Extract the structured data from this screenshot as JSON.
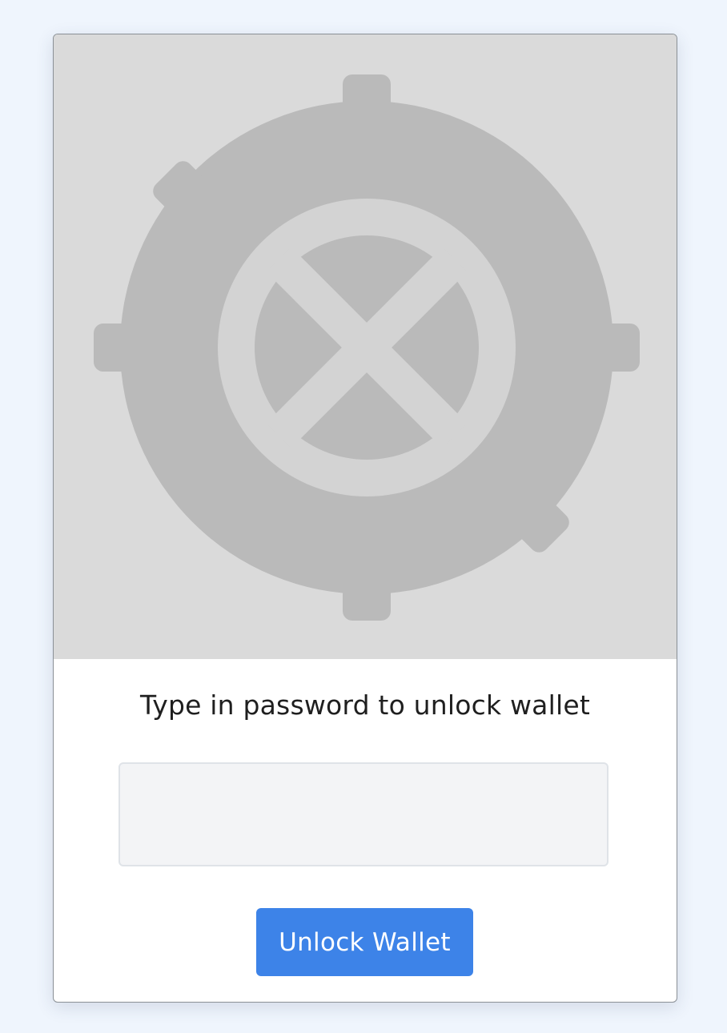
{
  "hero": {
    "icon": "vault-door-icon",
    "background_color": "#dadada",
    "icon_color": "#bababa",
    "inner_ring_color": "#d3d3d3"
  },
  "unlock": {
    "prompt": "Type in password to unlock wallet",
    "password_value": "",
    "button_label": "Unlock Wallet",
    "button_color": "#3d83e8"
  }
}
